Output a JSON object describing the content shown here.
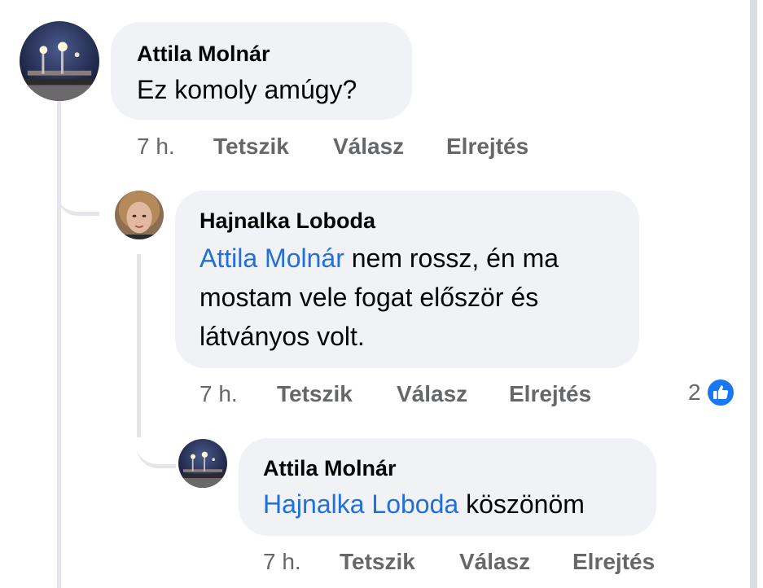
{
  "comments": [
    {
      "author": "Attila Molnár",
      "text": "Ez komoly amúgy?",
      "time": "7 h.",
      "actions": {
        "like": "Tetszik",
        "reply": "Válasz",
        "hide": "Elrejtés"
      }
    },
    {
      "author": "Hajnalka Loboda",
      "mention": "Attila Molnár",
      "text_line1": " nem rossz, én ma",
      "text_line2": "mostam vele fogat először és",
      "text_line3": "látványos volt.",
      "time": "7 h.",
      "actions": {
        "like": "Tetszik",
        "reply": "Válasz",
        "hide": "Elrejtés"
      },
      "reaction_count": "2",
      "reaction_icon": "like-icon"
    },
    {
      "author": "Attila Molnár",
      "mention": "Hajnalka Loboda",
      "text": " köszönöm",
      "time": "7 h.",
      "actions": {
        "like": "Tetszik",
        "reply": "Válasz",
        "hide": "Elrejtés"
      }
    }
  ],
  "colors": {
    "bubble": "#f0f2f5",
    "mention": "#216fdb",
    "meta": "#65676b",
    "like_badge": "#1877f2"
  }
}
